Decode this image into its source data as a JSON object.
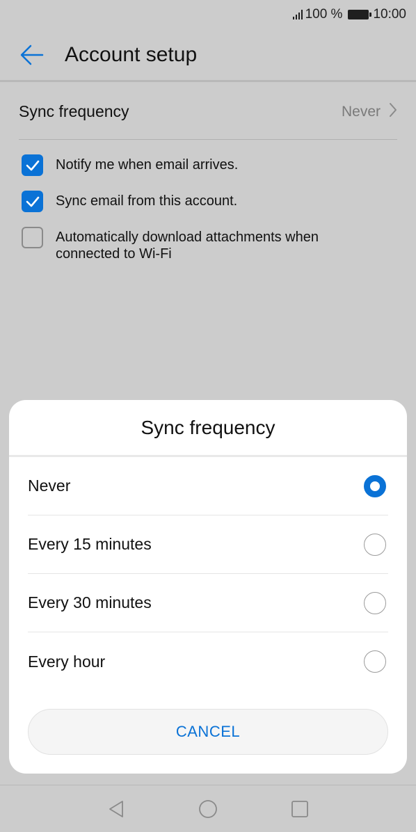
{
  "status_bar": {
    "battery_text": "100 %",
    "time": "10:00"
  },
  "header": {
    "title": "Account setup",
    "back_icon": "arrow-left-icon"
  },
  "settings": {
    "sync_frequency": {
      "label": "Sync frequency",
      "value": "Never"
    },
    "checkboxes": [
      {
        "label": "Notify me when email arrives.",
        "checked": true
      },
      {
        "label": "Sync email from this account.",
        "checked": true
      },
      {
        "label": "Automatically download attachments when connected to Wi-Fi",
        "checked": false
      }
    ]
  },
  "dialog": {
    "title": "Sync frequency",
    "options": [
      {
        "label": "Never",
        "selected": true
      },
      {
        "label": "Every 15 minutes",
        "selected": false
      },
      {
        "label": "Every 30 minutes",
        "selected": false
      },
      {
        "label": "Every hour",
        "selected": false
      }
    ],
    "cancel_label": "CANCEL"
  },
  "nav_bar": {
    "icons": [
      "back-triangle-icon",
      "home-circle-icon",
      "recents-square-icon"
    ]
  },
  "colors": {
    "accent": "#0a72d6",
    "scrim_background": "#cccccc"
  }
}
